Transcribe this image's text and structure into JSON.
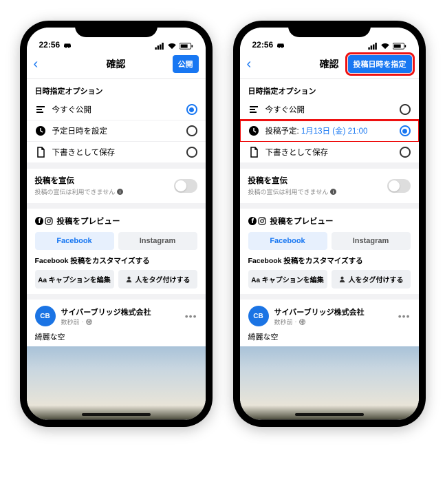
{
  "statusbar": {
    "time": "22:56"
  },
  "phones": [
    {
      "nav": {
        "title": "確認",
        "button": "公開",
        "highlight": false
      },
      "options_title": "日時指定オプション",
      "options": [
        {
          "icon": "publish",
          "label_prefix": "今すぐ公開",
          "label_sched": "",
          "selected": true,
          "highlight": false
        },
        {
          "icon": "clock",
          "label_prefix": "予定日時を設定",
          "label_sched": "",
          "selected": false,
          "highlight": false
        },
        {
          "icon": "draft",
          "label_prefix": "下書きとして保存",
          "label_sched": "",
          "selected": false,
          "highlight": false
        }
      ]
    },
    {
      "nav": {
        "title": "確認",
        "button": "投稿日時を指定",
        "highlight": true
      },
      "options_title": "日時指定オプション",
      "options": [
        {
          "icon": "publish",
          "label_prefix": "今すぐ公開",
          "label_sched": "",
          "selected": false,
          "highlight": false
        },
        {
          "icon": "clock",
          "label_prefix": "投稿予定: ",
          "label_sched": "1月13日 (金) 21:00",
          "selected": true,
          "highlight": true
        },
        {
          "icon": "draft",
          "label_prefix": "下書きとして保存",
          "label_sched": "",
          "selected": false,
          "highlight": false
        }
      ]
    }
  ],
  "promo": {
    "title": "投稿を宣伝",
    "sub": "投稿の宣伝は利用できません"
  },
  "preview": {
    "title": "投稿をプレビュー",
    "tabs": {
      "fb": "Facebook",
      "ig": "Instagram"
    },
    "cust_label": "Facebook 投稿をカスタマイズする",
    "btn_caption": "Aa キャプションを編集",
    "btn_tag": "人をタグ付けする"
  },
  "post": {
    "avatar": "CB",
    "name": "サイバーブリッジ株式会社",
    "time": "数秒前",
    "text": "綺麗な空"
  }
}
